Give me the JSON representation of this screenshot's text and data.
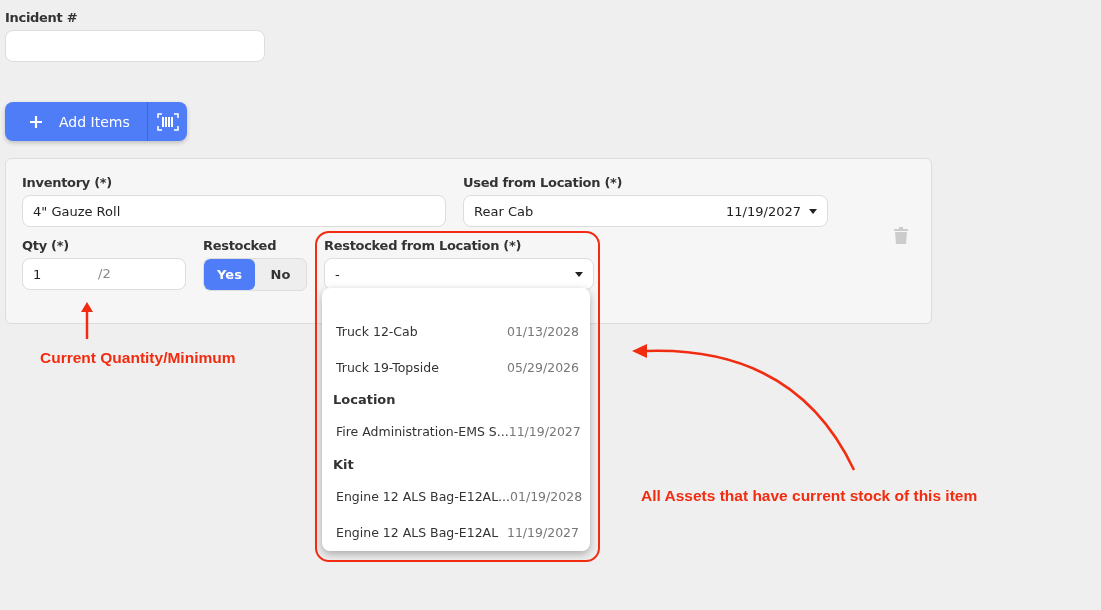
{
  "incident": {
    "label": "Incident #"
  },
  "add_button": {
    "label": "Add Items"
  },
  "item": {
    "inventory": {
      "label": "Inventory (*)",
      "value": "4\" Gauze Roll"
    },
    "used_from": {
      "label": "Used from Location (*)",
      "value": "Rear Cab",
      "date": "11/19/2027"
    },
    "qty": {
      "label": "Qty (*)",
      "value": "1",
      "minimum": "/2"
    },
    "restocked": {
      "label": "Restocked",
      "options": [
        {
          "label": "Yes",
          "selected": true
        },
        {
          "label": "No",
          "selected": false
        }
      ]
    },
    "restocked_from": {
      "label": "Restocked from Location (*)",
      "value": "-",
      "dropdown": [
        {
          "kind": "option",
          "name": "Truck 12-Cab",
          "date": "01/13/2028"
        },
        {
          "kind": "option",
          "name": "Truck 19-Topside",
          "date": "05/29/2026"
        },
        {
          "kind": "group",
          "name": "Location"
        },
        {
          "kind": "option",
          "name": "Fire Administration-EMS S...",
          "date": "11/19/2027"
        },
        {
          "kind": "group",
          "name": "Kit"
        },
        {
          "kind": "option",
          "name": "Engine 12 ALS Bag-E12AL...",
          "date": "01/19/2028"
        },
        {
          "kind": "option",
          "name": "Engine 12 ALS Bag-E12AL",
          "date": "11/19/2027"
        }
      ]
    }
  },
  "annotations": [
    {
      "text": "Current Quantity/Minimum"
    },
    {
      "text": "All Assets that have current stock of this item"
    }
  ]
}
